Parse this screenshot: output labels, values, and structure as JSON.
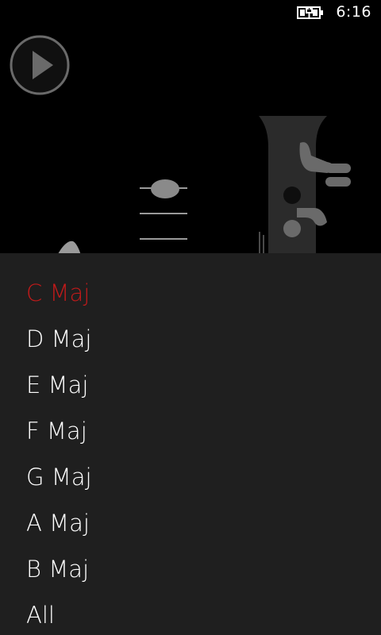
{
  "status_bar": {
    "time": "6:16",
    "battery_icon": "battery-charging-icon"
  },
  "player": {
    "play_icon": "play-icon"
  },
  "colors": {
    "accent_selected": "#c11a1a",
    "panel_bg": "#1f1f1f",
    "text": "#ffffff"
  },
  "scale_list": {
    "selected_index": 0,
    "items": [
      {
        "label": "C Maj"
      },
      {
        "label": "D Maj"
      },
      {
        "label": "E Maj"
      },
      {
        "label": "F Maj"
      },
      {
        "label": "G Maj"
      },
      {
        "label": "A Maj"
      },
      {
        "label": "B Maj"
      },
      {
        "label": "All"
      }
    ]
  }
}
